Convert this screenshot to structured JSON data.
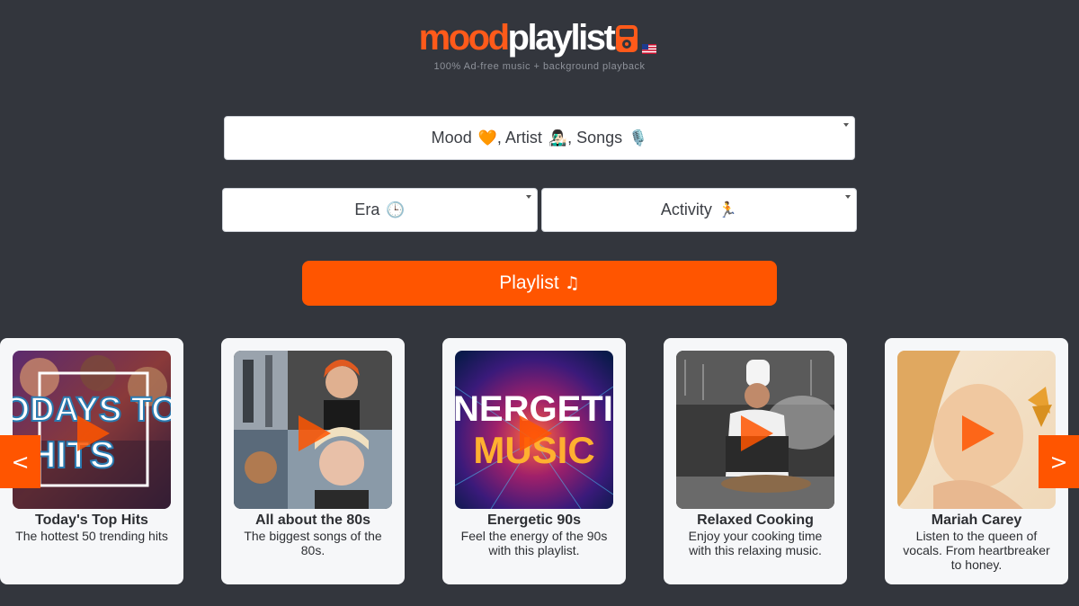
{
  "header": {
    "logo_part1": "mood",
    "logo_part2": "playlist",
    "logo_icon": "mp3-player-icon",
    "flag_icon": "us-flag-icon",
    "tagline": "100% Ad-free music + background playback"
  },
  "filters": {
    "mood": {
      "label": "Mood",
      "emoji1": "🧡",
      "artist_text": ", Artist",
      "emoji2": "👨🏻‍🎤",
      "songs_text": ", Songs",
      "emoji3": "🎙️"
    },
    "era": {
      "label": "Era",
      "emoji": "🕒"
    },
    "activity": {
      "label": "Activity",
      "emoji": "🏃"
    }
  },
  "playlist_button": {
    "label": "Playlist",
    "icon": "♫"
  },
  "carousel": {
    "prev_label": "<",
    "next_label": ">",
    "cards": [
      {
        "title": "Today's Top Hits",
        "description": "The hottest 50 trending hits",
        "image_text_1": "TODAYS TOP",
        "image_text_2": "HITS"
      },
      {
        "title": "All about the 80s",
        "description": "The biggest songs of the 80s."
      },
      {
        "title": "Energetic 90s",
        "description": "Feel the energy of the 90s with this playlist.",
        "image_text_1": "ENERGETIC",
        "image_text_2": "MUSIC"
      },
      {
        "title": "Relaxed Cooking",
        "description": "Enjoy your cooking time with this relaxing music."
      },
      {
        "title": "Mariah Carey",
        "description": "Listen to the queen of vocals. From heartbreaker to honey."
      }
    ]
  },
  "colors": {
    "background": "#33363d",
    "accent": "#ff5500",
    "card": "#f6f7f9"
  }
}
